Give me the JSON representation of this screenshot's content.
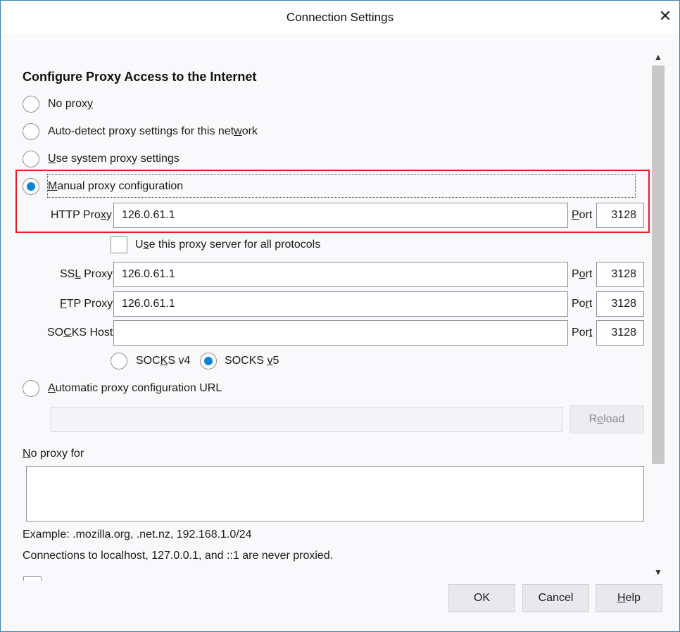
{
  "window": {
    "title": "Connection Settings",
    "close_glyph": "✕"
  },
  "heading": "Configure Proxy Access to the Internet",
  "options": {
    "no_proxy": {
      "pre": "No prox",
      "ul": "y",
      "post": "",
      "checked": false
    },
    "auto_detect": {
      "pre": "Auto-detect proxy settings for this net",
      "ul": "w",
      "post": "ork",
      "checked": false
    },
    "system": {
      "pre": "",
      "ul": "U",
      "post": "se system proxy settings",
      "checked": false
    },
    "manual": {
      "pre": "",
      "ul": "M",
      "post": "anual proxy configuration",
      "checked": true
    },
    "auto_url": {
      "pre": "",
      "ul": "A",
      "post": "utomatic proxy configuration URL",
      "checked": false
    }
  },
  "http": {
    "label_pre": "HTTP Pro",
    "label_ul": "x",
    "label_post": "y",
    "value": "126.0.61.1",
    "port_label_pre": "",
    "port_label_ul": "P",
    "port_label_post": "ort",
    "port": "3128"
  },
  "share": {
    "label_pre": "U",
    "label_ul": "s",
    "label_post": "e this proxy server for all protocols",
    "checked": false
  },
  "ssl": {
    "label_pre": "SS",
    "label_ul": "L",
    "label_post": " Proxy",
    "value": "126.0.61.1",
    "port_label_pre": "P",
    "port_label_ul": "o",
    "port_label_post": "rt",
    "port": "3128"
  },
  "ftp": {
    "label_pre": "",
    "label_ul": "F",
    "label_post": "TP Proxy",
    "value": "126.0.61.1",
    "port_label_pre": "Po",
    "port_label_ul": "r",
    "port_label_post": "t",
    "port": "3128"
  },
  "socks": {
    "label_pre": "SO",
    "label_ul": "C",
    "label_post": "KS Host",
    "value": "",
    "port_label_pre": "Por",
    "port_label_ul": "t",
    "port_label_post": "",
    "port": "3128"
  },
  "socks_v4": {
    "pre": "SOC",
    "ul": "K",
    "post": "S v4",
    "checked": false
  },
  "socks_v5": {
    "pre": "SOCKS ",
    "ul": "v",
    "post": "5",
    "checked": true
  },
  "autoconfig": {
    "url": "",
    "reload_pre": "R",
    "reload_ul": "e",
    "reload_post": "load"
  },
  "no_proxy_for": {
    "label_pre": "",
    "label_ul": "N",
    "label_post": "o proxy for",
    "value": ""
  },
  "example_text": "Example: .mozilla.org, .net.nz, 192.168.1.0/24",
  "localhost_note": "Connections to localhost, 127.0.0.1, and ::1 are never proxied.",
  "buttons": {
    "ok": "OK",
    "cancel": "Cancel",
    "help_ul": "H",
    "help_post": "elp"
  },
  "colors": {
    "accent": "#0a84d6",
    "highlight": "#e02020",
    "window_border": "#3c7fb1"
  }
}
